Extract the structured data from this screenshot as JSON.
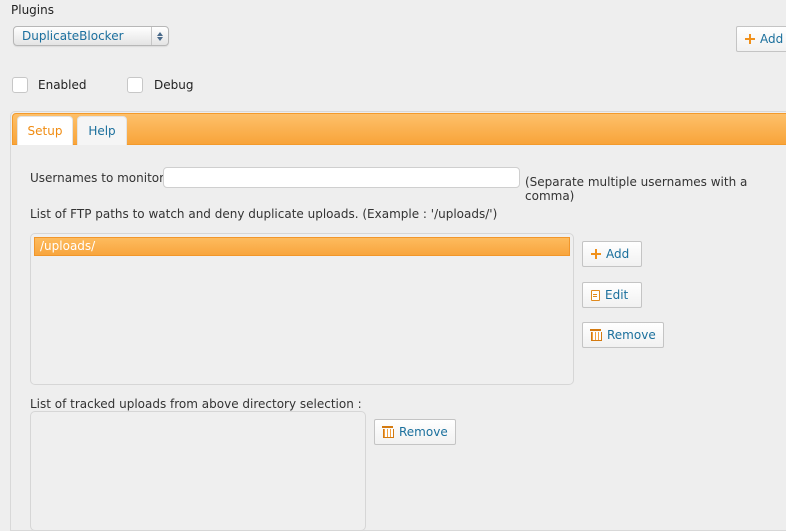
{
  "header": {
    "title": "Plugins"
  },
  "plugin_select": {
    "value": "DuplicateBlocker"
  },
  "top_add_button": {
    "label": "Add"
  },
  "options": {
    "enabled_label": "Enabled",
    "debug_label": "Debug"
  },
  "tabs": [
    {
      "label": "Setup"
    },
    {
      "label": "Help"
    }
  ],
  "setup": {
    "usernames_label": "Usernames to monitor :",
    "usernames_value": "",
    "usernames_hint": "(Separate multiple usernames with a comma)",
    "paths_label": "List of FTP paths to watch and deny duplicate uploads. (Example : '/uploads/')",
    "paths": [
      "/uploads/"
    ],
    "add_label": "Add",
    "edit_label": "Edit",
    "remove_label": "Remove",
    "tracked_label": "List of tracked uploads from above directory selection :",
    "tracked_remove_label": "Remove"
  },
  "colors": {
    "accent": "#f8a43a",
    "link": "#1a6f9c"
  }
}
